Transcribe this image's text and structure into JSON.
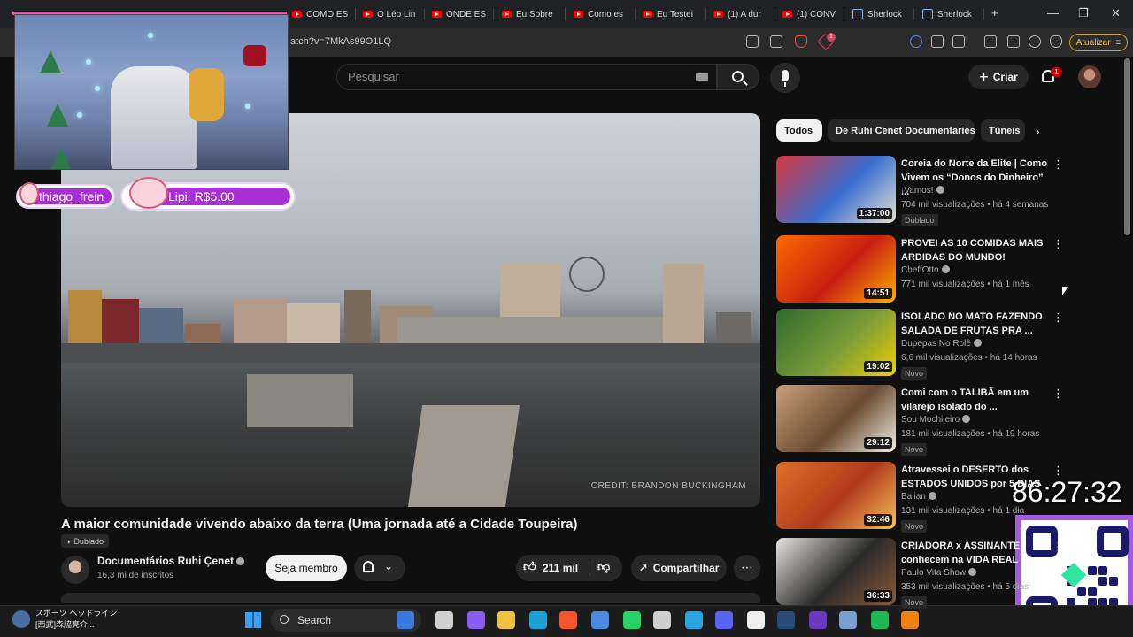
{
  "browser": {
    "tabs": [
      {
        "label": "COMO ES",
        "type": "yt"
      },
      {
        "label": "O Léo Lin",
        "type": "yt"
      },
      {
        "label": "ONDE ES",
        "type": "yt"
      },
      {
        "label": "Eu Sobre",
        "type": "yt"
      },
      {
        "label": "Como es",
        "type": "yt"
      },
      {
        "label": "Eu Testei",
        "type": "yt"
      },
      {
        "label": "(1) A dur",
        "type": "yt"
      },
      {
        "label": "(1) CONV",
        "type": "yt"
      },
      {
        "label": "Sherlock",
        "type": "other"
      },
      {
        "label": "Sherlock",
        "type": "other"
      }
    ],
    "new_tab": "+",
    "window_controls": [
      "—",
      "❐",
      "✕"
    ],
    "url": "atch?v=7MkAs99O1LQ",
    "update_button": "Atualizar",
    "brave_badge": "1"
  },
  "header": {
    "search_placeholder": "Pesquisar",
    "create_label": "Criar",
    "notifications_count": "1"
  },
  "overlay": {
    "chat_username": "thiago_frein",
    "donation_text": "Lipi: R$5.00",
    "timer": "86:27:32"
  },
  "video": {
    "credit": "CREDIT: BRANDON BUCKINGHAM",
    "title": "A maior comunidade vivendo abaixo da terra (Uma jornada até a Cidade Toupeira)",
    "dub_label": "Dublado",
    "channel_name": "Documentários Ruhi Çenet",
    "subscribers": "16,3 mi de inscritos",
    "join_label": "Seja membro",
    "likes": "211 mil",
    "share_label": "Compartilhar"
  },
  "chips": [
    {
      "label": "Todos",
      "active": true
    },
    {
      "label": "De Ruhi Cenet Documentaries",
      "active": false
    },
    {
      "label": "Túneis",
      "active": false
    }
  ],
  "recommendations": [
    {
      "title": "Coreia do Norte da Elite | Como Vivem os “Donos do Dinheiro” ...",
      "channel": "¡Vamos!",
      "meta": "704 mil visualizações • há 4 semanas",
      "duration": "1:37:00",
      "badge": "Dublado",
      "thumb_colors": [
        "#d9373f",
        "#3a6fd0",
        "#e8e0d0"
      ]
    },
    {
      "title": "PROVEI AS 10 COMIDAS MAIS ARDIDAS DO MUNDO!",
      "channel": "CheffOtto",
      "meta": "771 mil visualizações • há 1 mês",
      "duration": "14:51",
      "badge": "",
      "thumb_colors": [
        "#ff6a00",
        "#c81e10",
        "#ffb000"
      ]
    },
    {
      "title": "ISOLADO NO MATO FAZENDO SALADA DE FRUTAS PRA ...",
      "channel": "Dupepas No Rolê",
      "meta": "6,6 mil visualizações • há 14 horas",
      "duration": "19:02",
      "badge": "Novo",
      "thumb_colors": [
        "#2e6b2a",
        "#7a9a3a",
        "#f0d000"
      ]
    },
    {
      "title": "Comi com o TALIBÃ em um vilarejo isolado do ...",
      "channel": "Sou Mochileiro",
      "meta": "181 mil visualizações • há 19 horas",
      "duration": "29:12",
      "badge": "Novo",
      "thumb_colors": [
        "#c9a07a",
        "#6b4a30",
        "#f2efe8"
      ]
    },
    {
      "title": "Atravessei o DESERTO dos ESTADOS UNIDOS por 5 DIAS",
      "channel": "Balian",
      "meta": "131 mil visualizações • há 1 dia",
      "duration": "32:46",
      "badge": "Novo",
      "thumb_colors": [
        "#e0702a",
        "#b03a1a",
        "#f7c05a"
      ]
    },
    {
      "title": "CRIADORA x ASSINANTE: conhecem na VIDA REAL",
      "channel": "Paulo Vita Show",
      "meta": "353 mil visualizações • há 5 dias",
      "duration": "36:33",
      "badge": "Novo",
      "thumb_colors": [
        "#e8e4dc",
        "#2a2a2a",
        "#8a5a3a"
      ]
    }
  ],
  "taskbar": {
    "news_line1": "スポーツ ヘッドライン",
    "news_line2": "[西武]森脇亮介...",
    "search_label": "Search"
  }
}
